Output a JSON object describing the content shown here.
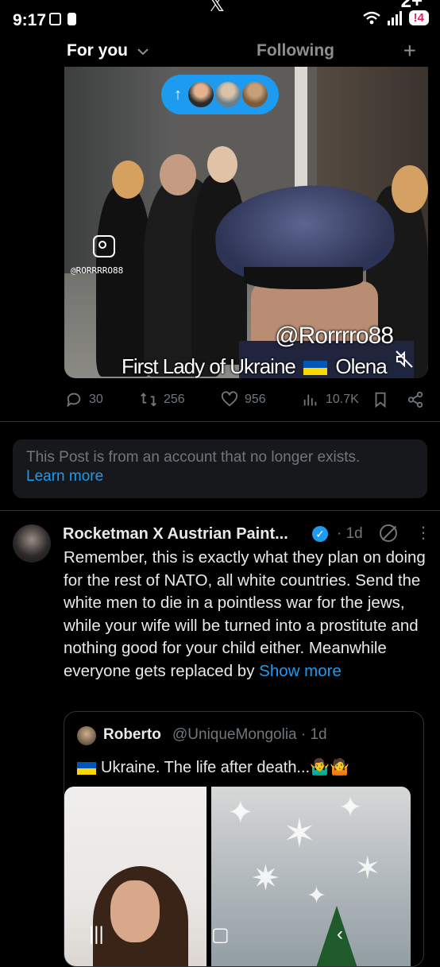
{
  "status": {
    "time": "9:17",
    "battery": "4"
  },
  "tabs": {
    "for_you": "For you",
    "following": "Following"
  },
  "video": {
    "instagram_handle": "@RORRRRO88",
    "watermark": "@Rorrrro88",
    "caption_part1": "First Lady of Ukraine",
    "caption_part2": "Olena"
  },
  "post_actions": {
    "replies": "30",
    "reposts": "256",
    "likes": "956",
    "views": "10.7K"
  },
  "notice": {
    "text": "This Post is from an account that no longer exists.",
    "link": "Learn more"
  },
  "tweet": {
    "name": "Rocketman X Austrian Paint...",
    "time": "· 1d",
    "body": "Remember, this is exactly what they plan on doing for the rest of NATO, all white countries. Send the white men to die in a pointless war for the jews, while your wife will be turned into a prostitute and nothing good for your child either. Meanwhile everyone gets replaced by",
    "show_more": "Show more"
  },
  "quote": {
    "name": "Roberto",
    "handle": "@UniqueMongolia · 1d",
    "text": "Ukraine. The life after death...🤷‍♂️🤷"
  },
  "colors": {
    "accent": "#1d9bf0",
    "muted": "#71767b",
    "background": "#000000"
  },
  "icons": [
    "screen-record-icon",
    "alert-icon",
    "wifi-icon",
    "signal-icon",
    "battery-icon",
    "chevron-down-icon",
    "plus-icon",
    "arrow-up-icon",
    "instagram-icon",
    "mute-icon",
    "reply-icon",
    "repost-icon",
    "like-icon",
    "views-icon",
    "bookmark-icon",
    "share-icon",
    "verified-icon",
    "grok-icon",
    "more-icon",
    "recents-icon",
    "home-icon",
    "back-icon"
  ]
}
